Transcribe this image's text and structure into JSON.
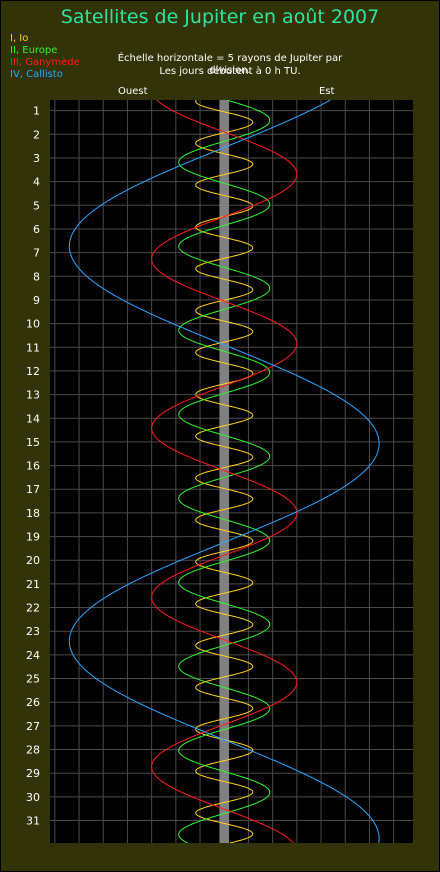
{
  "title": "Satellites de Jupiter en août 2007",
  "legend": [
    {
      "label": "I, Io",
      "color": "#ffd21c"
    },
    {
      "label": "II, Europe",
      "color": "#2ef62e"
    },
    {
      "label": "III, Ganymède",
      "color": "#ff1c1c"
    },
    {
      "label": "IV, Callisto",
      "color": "#2aa8ff"
    }
  ],
  "notes": {
    "scale": "Échelle horizontale = 5 rayons de Jupiter par division.",
    "days": "Les jours débutent à 0 h TU."
  },
  "directions": {
    "west": "Ouest",
    "east": "Est"
  },
  "colors": {
    "background": "#33330a",
    "plot_background": "#000000",
    "grid": "#4a4a4a",
    "jupiter_band": "#808080",
    "title": "#2ee4a0"
  },
  "chart_data": {
    "type": "line",
    "title": "Satellites de Jupiter en août 2007",
    "x_unit": "rayons de Jupiter",
    "x_range": [
      -36,
      39
    ],
    "x_grid_step": 5,
    "y_unit": "jour",
    "y_ticks": [
      1,
      2,
      3,
      4,
      5,
      6,
      7,
      8,
      9,
      10,
      11,
      12,
      13,
      14,
      15,
      16,
      17,
      18,
      19,
      20,
      21,
      22,
      23,
      24,
      25,
      26,
      27,
      28,
      29,
      30,
      31
    ],
    "y_range": [
      0.55,
      31.95
    ],
    "grid": true,
    "jupiter_radius": 1,
    "series": [
      {
        "name": "I, Io",
        "color": "#ffd21c",
        "amplitude": 5.9,
        "period_days": 1.769,
        "phase_day_zero_crossing": 1.05
      },
      {
        "name": "II, Europe",
        "color": "#2ef62e",
        "amplitude": 9.4,
        "period_days": 3.551,
        "phase_day_zero_crossing": 0.52
      },
      {
        "name": "III, Ganymède",
        "color": "#ff1c1c",
        "amplitude": 15.0,
        "period_days": 7.155,
        "phase_day_zero_crossing": 1.9
      },
      {
        "name": "IV, Callisto",
        "color": "#2aa8ff",
        "amplitude": 32.0,
        "period_days": 16.689,
        "phase_day_zero_crossing": 10.9
      }
    ]
  }
}
